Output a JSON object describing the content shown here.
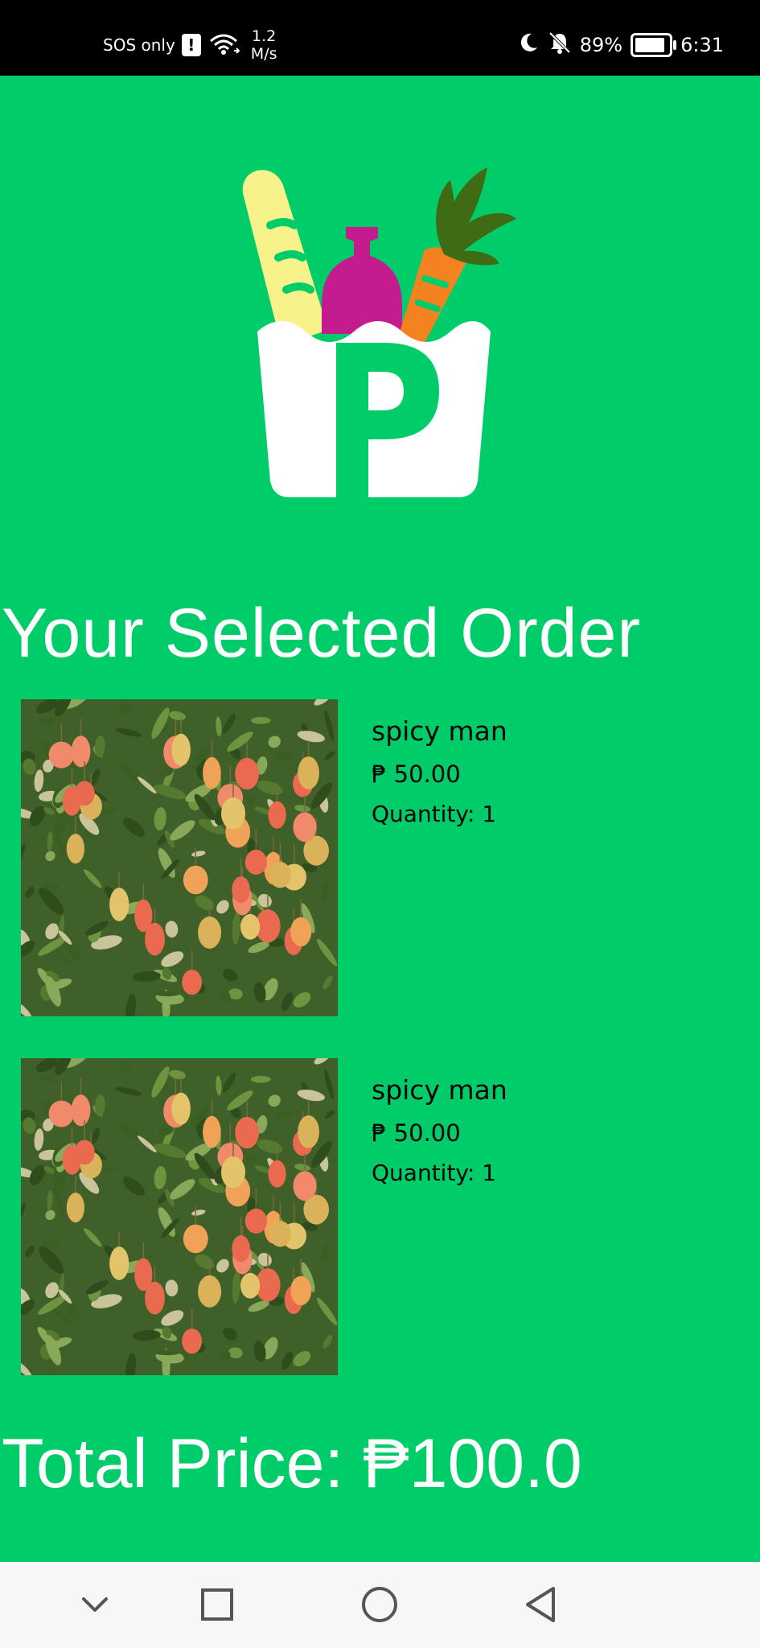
{
  "status_bar": {
    "sos": "SOS only",
    "speed_value": "1.2",
    "speed_unit": "M/s",
    "battery": "89%",
    "time": "6:31",
    "battery_level": 0.89
  },
  "logo": {
    "letter": "P",
    "colors": {
      "bag": "#ffffff",
      "bread": "#f7f28a",
      "bottle": "#c41b8f",
      "carrot": "#f58220",
      "leaves": "#3f6b14"
    }
  },
  "page_title": "Your Selected Order",
  "items": [
    {
      "name": "spicy man",
      "price": "₱ 50.00",
      "quantity": "Quantity: 1",
      "image": "mango-tree-photo"
    },
    {
      "name": "spicy man",
      "price": "₱ 50.00",
      "quantity": "Quantity: 1",
      "image": "mango-tree-photo"
    }
  ],
  "total": "Total Price: ₱100.0",
  "nav": {
    "icons": [
      "chevron-down-icon",
      "square-icon",
      "circle-icon",
      "back-triangle-icon"
    ]
  },
  "colors": {
    "background": "#00cd6a",
    "text_white": "#ffffff",
    "text_dark": "#000000"
  }
}
